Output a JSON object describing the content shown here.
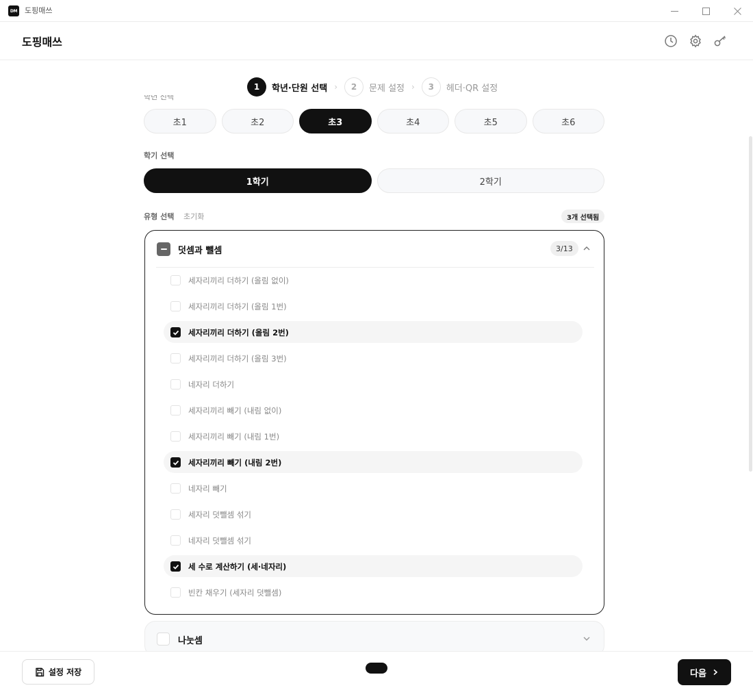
{
  "window": {
    "logo_text": "DM",
    "title": "도핑매쓰"
  },
  "header": {
    "brand": "도핑매쓰"
  },
  "stepper": {
    "steps": [
      {
        "num": "1",
        "label": "학년·단원 선택"
      },
      {
        "num": "2",
        "label": "문제 설정"
      },
      {
        "num": "3",
        "label": "헤더·QR 설정"
      }
    ],
    "active_step": 1
  },
  "grade": {
    "label": "학년 선택",
    "options": [
      "초1",
      "초2",
      "초3",
      "초4",
      "초5",
      "초6"
    ],
    "selected": "초3"
  },
  "semester": {
    "label": "학기 선택",
    "options": [
      "1학기",
      "2학기"
    ],
    "selected": "1학기"
  },
  "type": {
    "label": "유형 선택",
    "reset": "초기화",
    "selected_badge": "3개 선택됨"
  },
  "categories": [
    {
      "title": "덧셈과 뺄셈",
      "count": "3/13",
      "items": [
        {
          "label": "세자리끼리 더하기 (올림 없이)",
          "checked": false
        },
        {
          "label": "세자리끼리 더하기 (올림 1번)",
          "checked": false
        },
        {
          "label": "세자리끼리 더하기 (올림 2번)",
          "checked": true
        },
        {
          "label": "세자리끼리 더하기 (올림 3번)",
          "checked": false
        },
        {
          "label": "네자리 더하기",
          "checked": false
        },
        {
          "label": "세자리끼리 빼기 (내림 없이)",
          "checked": false
        },
        {
          "label": "세자리끼리 빼기 (내림 1번)",
          "checked": false
        },
        {
          "label": "세자리끼리 빼기 (내림 2번)",
          "checked": true
        },
        {
          "label": "네자리 빼기",
          "checked": false
        },
        {
          "label": "세자리 덧뺄셈 섞기",
          "checked": false
        },
        {
          "label": "네자리 덧뺄셈 섞기",
          "checked": false
        },
        {
          "label": "세 수로 계산하기 (세·네자리)",
          "checked": true
        },
        {
          "label": "빈칸 채우기 (세자리 덧뺄셈)",
          "checked": false
        }
      ]
    },
    {
      "title": "나눗셈"
    }
  ],
  "footer": {
    "save_label": "설정 저장",
    "next_label": "다음"
  }
}
